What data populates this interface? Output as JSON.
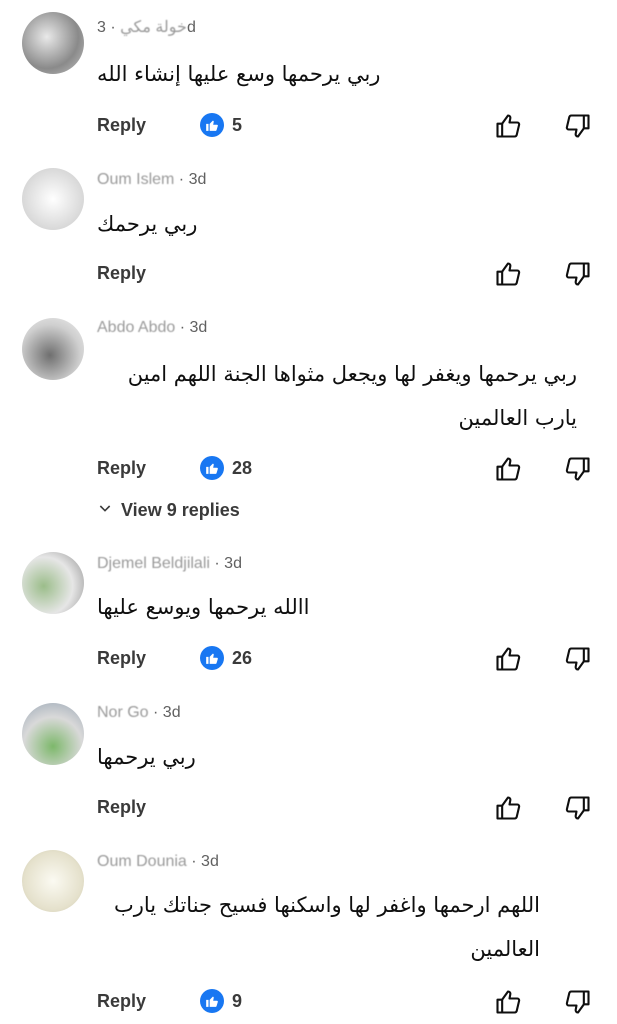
{
  "comments": [
    {
      "author": "خولة مكي",
      "time": "· 3d",
      "text": [
        "ربي يرحمها وسع عليها إنشاء الله"
      ],
      "reply_label": "Reply",
      "likes": "5"
    },
    {
      "author": "Oum Islem",
      "time": "· 3d",
      "text": [
        "ربي يرحمك"
      ],
      "reply_label": "Reply",
      "likes": ""
    },
    {
      "author": "Abdo Abdo",
      "time": "· 3d",
      "text": [
        "ربي يرحمها ويغفر لها ويجعل مثواها الجنة اللهم امين",
        "يارب العالمين"
      ],
      "reply_label": "Reply",
      "likes": "28",
      "view_replies": "View 9 replies"
    },
    {
      "author": "Djemel Beldjilali",
      "time": "· 3d",
      "text": [
        "االله يرحمها ويوسع عليها"
      ],
      "reply_label": "Reply",
      "likes": "26"
    },
    {
      "author": "Nor Go",
      "time": "· 3d",
      "text": [
        "ربي يرحمها"
      ],
      "reply_label": "Reply",
      "likes": ""
    },
    {
      "author": "Oum Dounia",
      "time": "· 3d",
      "text": [
        "اللهم ارحمها واغفر لها واسكنها فسيح جناتك يارب",
        "العالمين"
      ],
      "reply_label": "Reply",
      "likes": "9"
    }
  ],
  "icons": {
    "like_badge": "thumbs-up-badge-icon",
    "like": "thumbs-up-outline-icon",
    "dislike": "thumbs-down-outline-icon",
    "chevron": "chevron-down-icon"
  },
  "colors": {
    "like_badge": "#1877f2",
    "text": "#0f0f0f",
    "meta": "#606060"
  }
}
